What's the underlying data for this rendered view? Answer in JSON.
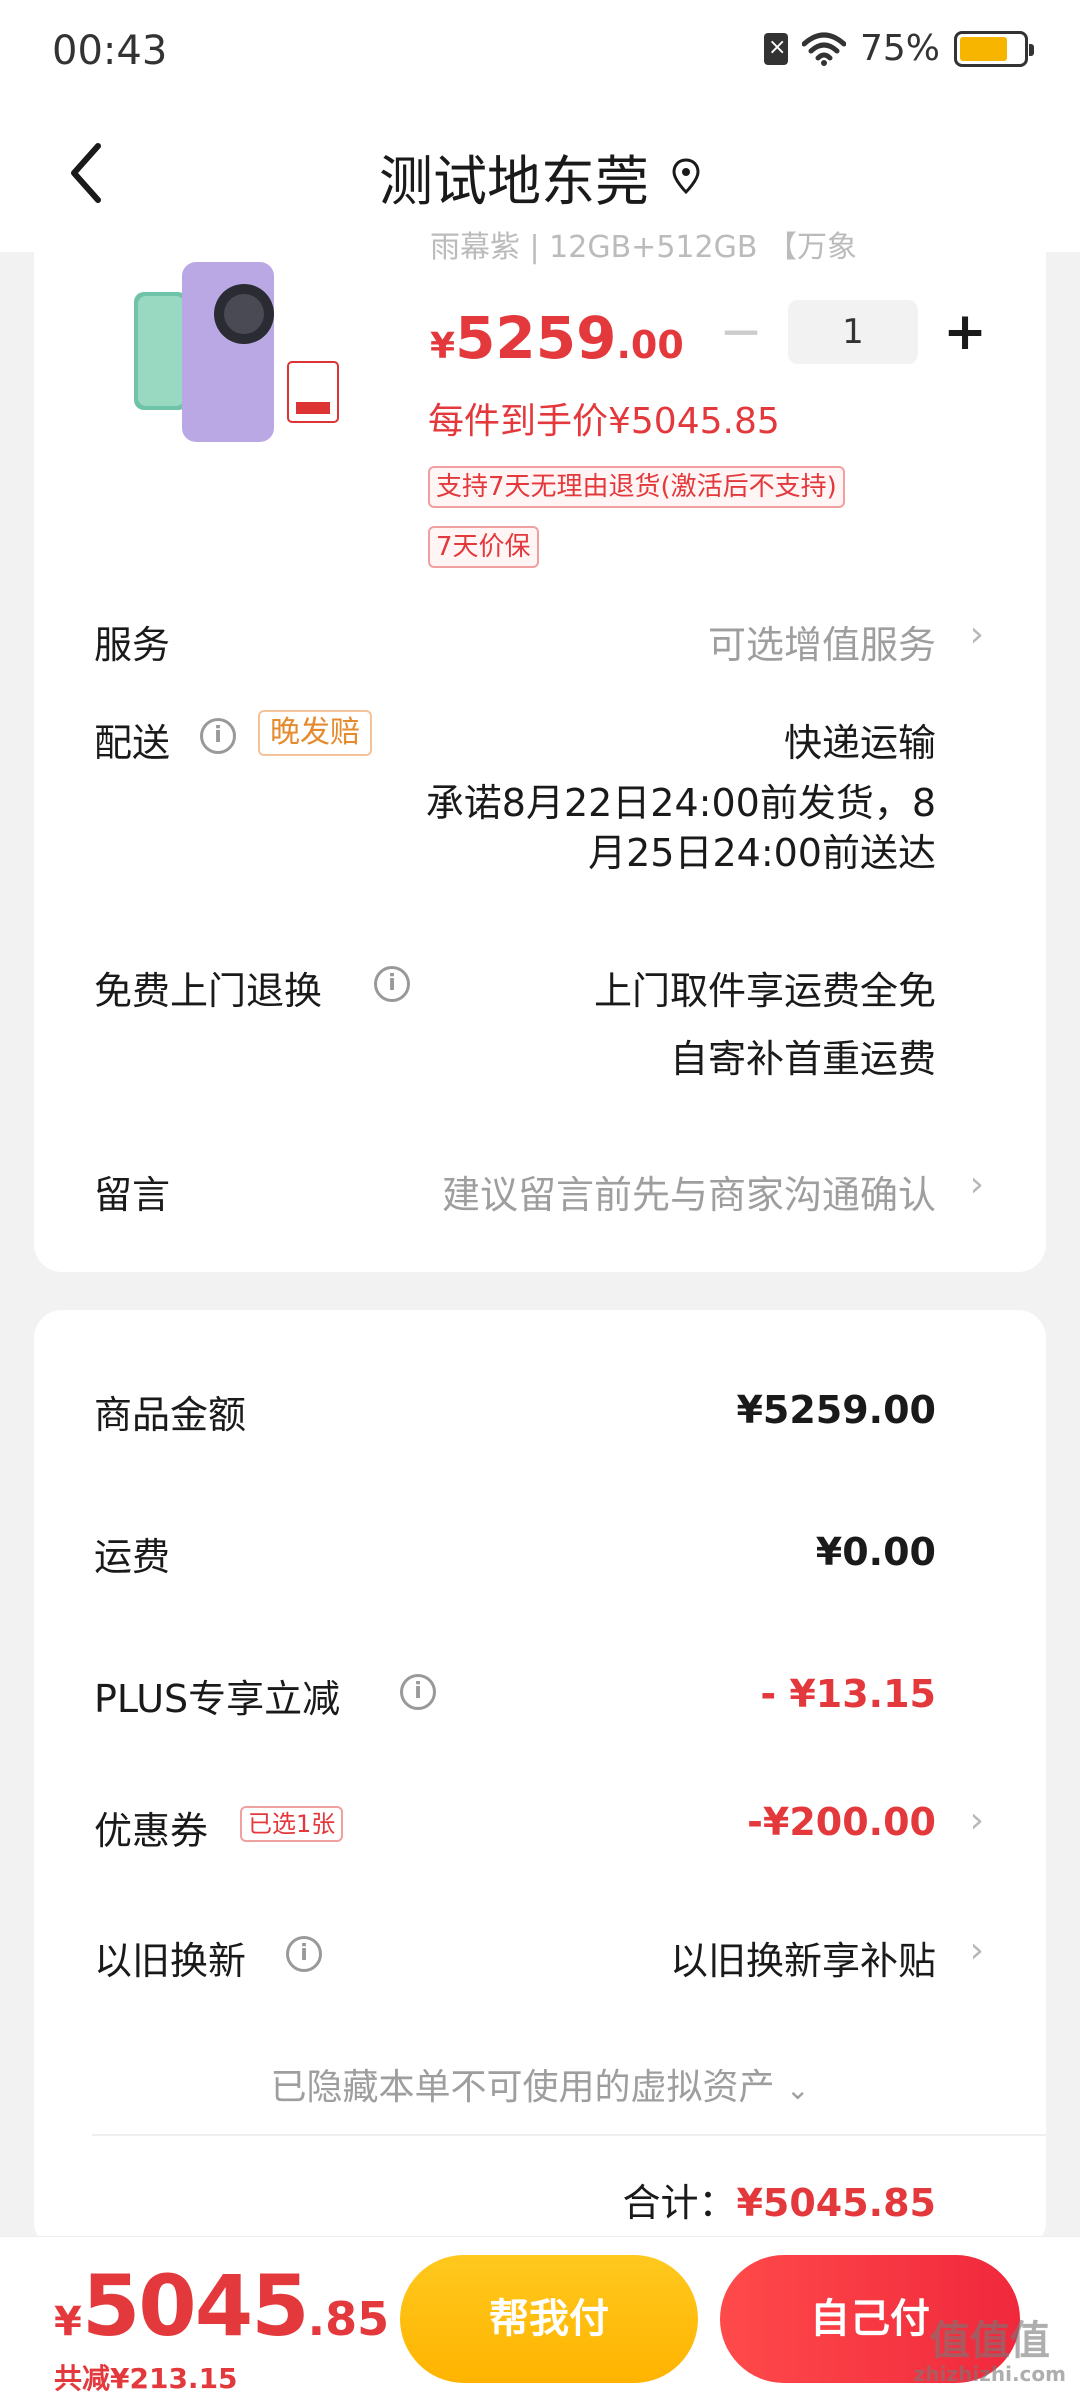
{
  "status_bar": {
    "time": "00:43",
    "battery": "75%",
    "battery_level": 0.75,
    "battery_color": "#f7b500"
  },
  "nav": {
    "title": "测试地东莞"
  },
  "product": {
    "spec": "雨幕紫 | 12GB+512GB 【万象",
    "price_symbol": "¥",
    "price_int": "5259",
    "price_dec": ".00",
    "quantity": "1",
    "minus": "−",
    "plus": "+",
    "unit_price": "每件到手价¥5045.85",
    "tags": [
      "支持7天无理由退货(激活后不支持)",
      "7天价保"
    ]
  },
  "rows": {
    "service": {
      "label": "服务",
      "value": "可选增值服务"
    },
    "delivery": {
      "label": "配送",
      "badge": "晚发赔",
      "method": "快递运输",
      "promise_line1": "承诺8月22日24:00前发货，8",
      "promise_line2": "月25日24:00前送达"
    },
    "return": {
      "label": "免费上门退换",
      "line1": "上门取件享运费全免",
      "line2": "自寄补首重运费"
    },
    "note": {
      "label": "留言",
      "placeholder": "建议留言前先与商家沟通确认"
    }
  },
  "summary": {
    "goods_amount": {
      "label": "商品金额",
      "value": "¥5259.00"
    },
    "shipping": {
      "label": "运费",
      "value": "¥0.00"
    },
    "plus_discount": {
      "label": "PLUS专享立减",
      "value": "- ¥13.15"
    },
    "coupon": {
      "label": "优惠券",
      "badge": "已选1张",
      "value": "-¥200.00"
    },
    "trade_in": {
      "label": "以旧换新",
      "value": "以旧换新享补贴"
    },
    "hidden_assets": "已隐藏本单不可使用的虚拟资产",
    "total_label": "合计：",
    "total_value": "¥5045.85"
  },
  "bottom": {
    "price_symbol": "¥",
    "price_int": "5045",
    "price_dec": ".85",
    "saved": "共减¥213.15",
    "help_pay": "帮我付",
    "self_pay": "自己付"
  },
  "watermark": {
    "main": "值值值",
    "sub": "zhizhizhi.com"
  },
  "colors": {
    "accent_red": "#e4393c",
    "button_yellow": "#ffb400",
    "button_red": "#f0283c"
  }
}
